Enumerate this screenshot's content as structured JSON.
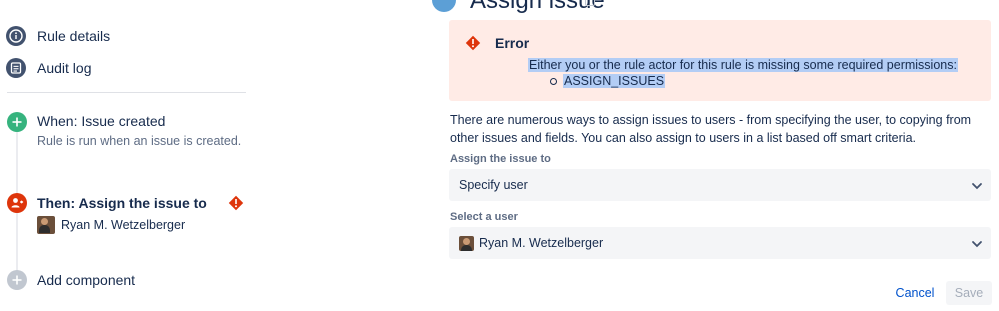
{
  "sidebar": {
    "nav": [
      {
        "label": "Rule details",
        "icon": "info-icon"
      },
      {
        "label": "Audit log",
        "icon": "list-icon"
      }
    ],
    "trigger": {
      "title": "When: Issue created",
      "subtitle": "Rule is run when an issue is created.",
      "icon": "plus-icon",
      "color": "#36b37e"
    },
    "action": {
      "title": "Then: Assign the issue to",
      "user": "Ryan M. Wetzelberger",
      "icon": "assign-user-icon",
      "color": "#de350b",
      "warning_icon": "error-diamond-icon"
    },
    "add": {
      "label": "Add component",
      "icon": "plus-icon",
      "color": "#c1c7d0"
    }
  },
  "header": {
    "title": "Assign issue"
  },
  "error": {
    "title": "Error",
    "message": "Either you or the rule actor for this rule is missing some required permissions:",
    "permissions": [
      "ASSIGN_ISSUES"
    ],
    "color": "#de350b",
    "background": "#ffebe6"
  },
  "description": "There are numerous ways to assign issues to users - from specifying the user, to copying from other issues and fields. You can also assign to users in a list based off smart criteria.",
  "fields": {
    "assign_to": {
      "label": "Assign the issue to",
      "value": "Specify user"
    },
    "user": {
      "label": "Select a user",
      "value": "Ryan M. Wetzelberger"
    }
  },
  "buttons": {
    "cancel": "Cancel",
    "save": "Save"
  },
  "colors": {
    "link": "#0052cc",
    "text": "#172b4d",
    "muted": "#5e6c84"
  }
}
